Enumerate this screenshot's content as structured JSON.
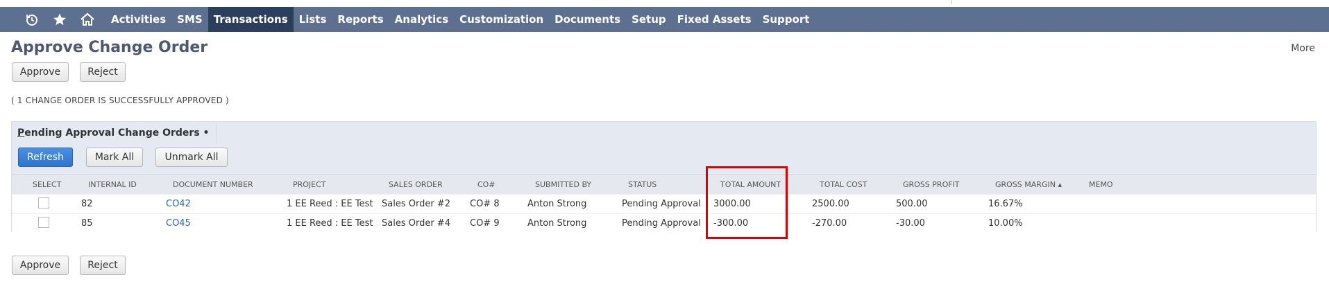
{
  "nav": {
    "icons": [
      "history-icon",
      "star-icon",
      "home-icon"
    ],
    "items": [
      "Activities",
      "SMS",
      "Transactions",
      "Lists",
      "Reports",
      "Analytics",
      "Customization",
      "Documents",
      "Setup",
      "Fixed Assets",
      "Support"
    ],
    "active": "Transactions"
  },
  "page": {
    "title": "Approve Change Order",
    "more": "More",
    "approve_label": "Approve",
    "reject_label": "Reject",
    "status_message": "( 1 CHANGE ORDER IS SUCCESSFULLY APPROVED )"
  },
  "sublist": {
    "tab_first_letter": "P",
    "tab_rest": "ending Approval Change Orders •",
    "refresh_label": "Refresh",
    "mark_all_label": "Mark All",
    "unmark_all_label": "Unmark All"
  },
  "columns": [
    "SELECT",
    "INTERNAL ID",
    "DOCUMENT NUMBER",
    "PROJECT",
    "SALES ORDER",
    "CO#",
    "SUBMITTED BY",
    "STATUS",
    "TOTAL AMOUNT",
    "TOTAL COST",
    "GROSS PROFIT",
    "GROSS MARGIN ▴",
    "MEMO"
  ],
  "rows": [
    {
      "select": false,
      "internal_id": "82",
      "document_number": "CO42",
      "project": "1 EE Reed : EE Test",
      "sales_order": "Sales Order #2",
      "co_number": "CO# 8",
      "submitted_by": "Anton Strong",
      "status": "Pending Approval",
      "total_amount": "3000.00",
      "total_cost": "2500.00",
      "gross_profit": "500.00",
      "gross_margin": "16.67%",
      "memo": ""
    },
    {
      "select": false,
      "internal_id": "85",
      "document_number": "CO45",
      "project": "1 EE Reed : EE Test",
      "sales_order": "Sales Order #4",
      "co_number": "CO# 9",
      "submitted_by": "Anton Strong",
      "status": "Pending Approval",
      "total_amount": "-300.00",
      "total_cost": "-270.00",
      "gross_profit": "-30.00",
      "gross_margin": "10.00%",
      "memo": ""
    }
  ],
  "colors": {
    "nav_bg": "#5e7090",
    "nav_active": "#2b3e5c",
    "title": "#4b5a72",
    "highlight": "#e00000",
    "primary_button": "#2d74cf"
  }
}
